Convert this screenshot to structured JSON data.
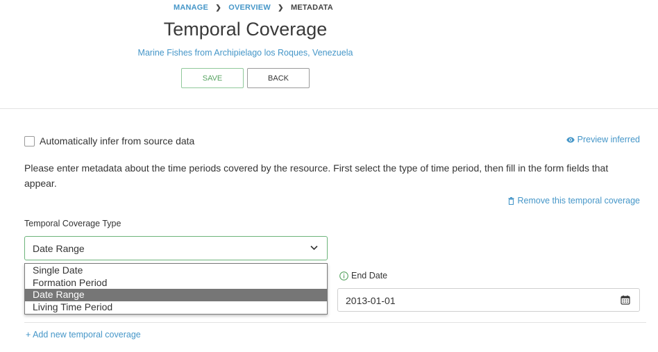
{
  "breadcrumb": {
    "manage": "MANAGE",
    "overview": "OVERVIEW",
    "current": "METADATA"
  },
  "header": {
    "title": "Temporal Coverage",
    "subtitle": "Marine Fishes from Archipielago los Roques, Venezuela",
    "save_label": "SAVE",
    "back_label": "BACK"
  },
  "infer": {
    "label": "Automatically infer from source data",
    "checked": false
  },
  "preview_label": "Preview inferred",
  "intro_text": "Please enter metadata about the time periods covered by the resource. First select the type of time period, then fill in the form fields that appear.",
  "remove_label": "Remove this temporal coverage",
  "coverage_type": {
    "label": "Temporal Coverage Type",
    "selected": "Date Range",
    "options": [
      "Single Date",
      "Formation Period",
      "Date Range",
      "Living Time Period"
    ],
    "selected_index": 2
  },
  "end_date": {
    "label": "End Date",
    "value": "2013-01-01"
  },
  "add_label": "+ Add new temporal coverage",
  "colors": {
    "accent": "#4596c8",
    "save_green": "#58a462",
    "selected_option": "#767676"
  },
  "icons": {
    "preview": "eye-icon",
    "remove": "trash-icon",
    "select": "chevron-down-icon",
    "info": "info-icon",
    "calendar": "calendar-icon"
  }
}
